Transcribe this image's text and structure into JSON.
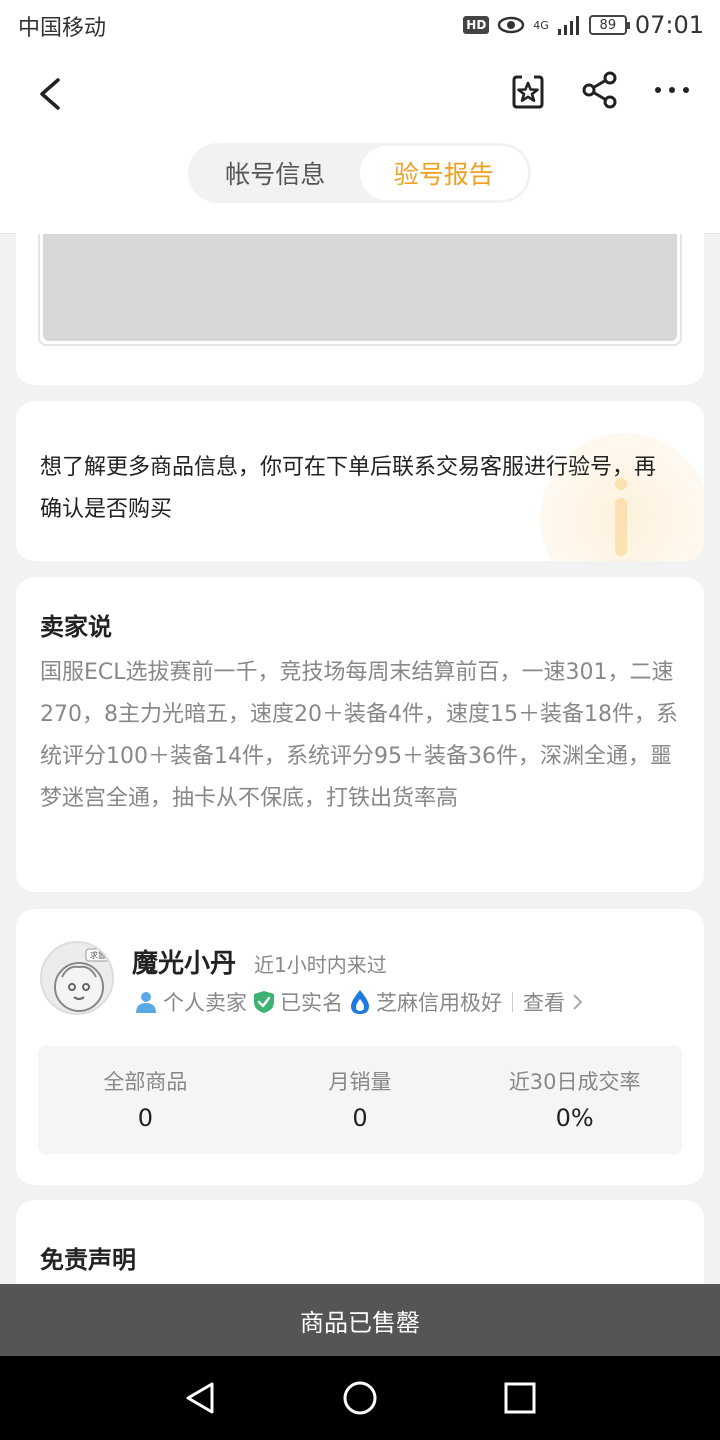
{
  "status": {
    "carrier": "中国移动",
    "hd": "HD",
    "network": "4G",
    "battery": "89",
    "time": "07:01"
  },
  "tabs": [
    {
      "label": "帐号信息",
      "active": false
    },
    {
      "label": "验号报告",
      "active": true
    }
  ],
  "notice": {
    "text": "想了解更多商品信息，你可在下单后联系交易客服进行验号，再确认是否购买"
  },
  "seller_says": {
    "title": "卖家说",
    "text": "国服ECL选拔赛前一千，竞技场每周末结算前百，一速301，二速270，8主力光暗五，速度20＋装备4件，速度15＋装备18件，系统评分100＋装备14件，系统评分95＋装备36件，深渊全通，噩梦迷宫全通，抽卡从不保底，打铁出货率高"
  },
  "seller": {
    "name": "魔光小丹",
    "last_seen": "近1小时内来过",
    "tag_personal": "个人卖家",
    "tag_verified": "已实名",
    "tag_credit": "芝麻信用极好",
    "view_label": "查看",
    "avatar_badge": "求置"
  },
  "stats": [
    {
      "label": "全部商品",
      "value": "0"
    },
    {
      "label": "月销量",
      "value": "0"
    },
    {
      "label": "近30日成交率",
      "value": "0%"
    }
  ],
  "disclaimer": {
    "title": "免责声明"
  },
  "sold_label": "商品已售罄",
  "colors": {
    "accent": "#f0a020",
    "verified_green": "#3cb371",
    "credit_blue": "#1f7ae0",
    "person_blue": "#5aa9e6",
    "sold_bar": "#555555"
  }
}
